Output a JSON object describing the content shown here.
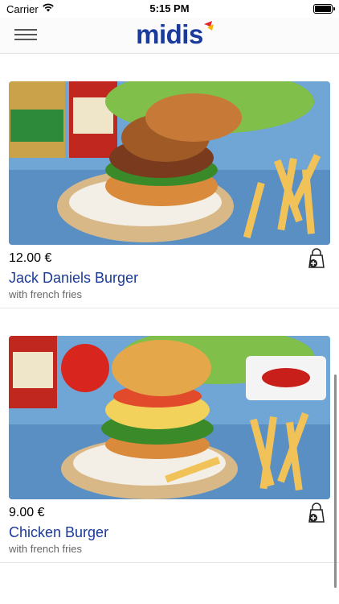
{
  "status_bar": {
    "carrier": "Carrier",
    "time": "5:15 PM"
  },
  "header": {
    "logo_text": "midis"
  },
  "products": [
    {
      "price": "12.00 €",
      "name": "Jack Daniels Burger",
      "description": "with french fries"
    },
    {
      "price": "9.00 €",
      "name": "Chicken Burger",
      "description": "with french fries"
    }
  ],
  "icons": {
    "menu": "hamburger-menu-icon",
    "cart": "shopping-bag-add-icon",
    "wifi": "wifi-icon",
    "battery": "battery-icon"
  },
  "colors": {
    "brand": "#1a3a9c",
    "logo_accent_red": "#e4262d",
    "logo_accent_yellow": "#f4b400"
  }
}
